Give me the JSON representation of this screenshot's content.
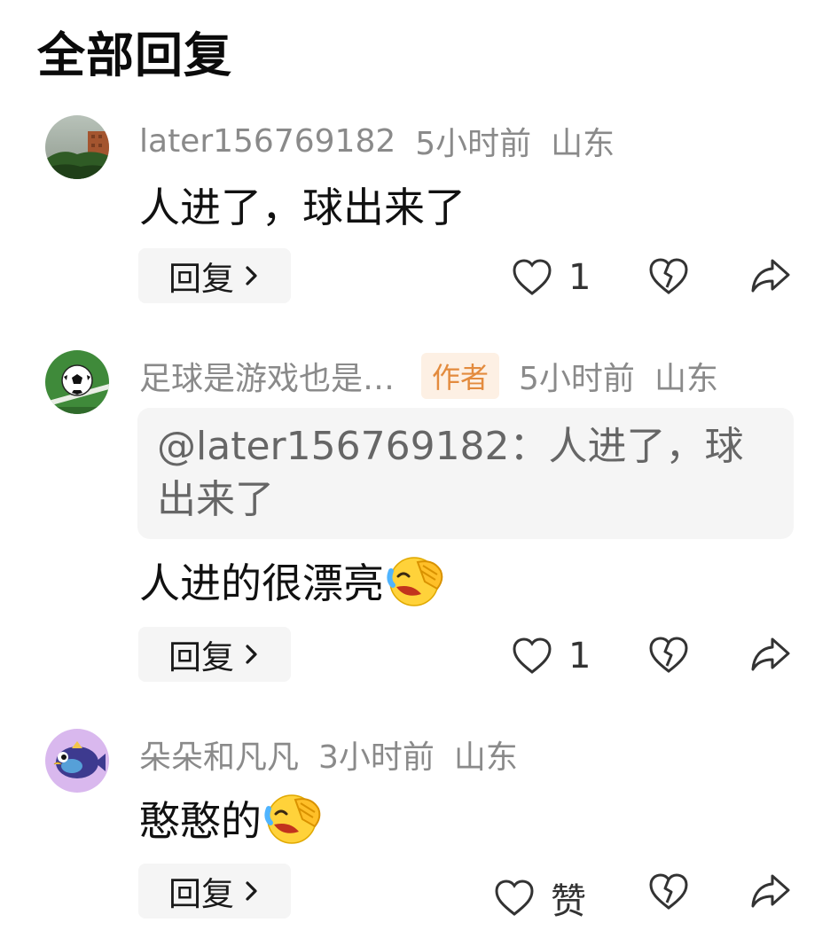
{
  "page": {
    "title": "全部回复"
  },
  "comments": [
    {
      "username": "later156769182",
      "time": "5小时前",
      "location": "山东",
      "text": "人进了，球出来了",
      "reply_label": "回复",
      "like_count": "1"
    },
    {
      "username": "足球是游戏也是…",
      "badge": "作者",
      "time": "5小时前",
      "location": "山东",
      "quote": "@later156769182：人进了，球出来了",
      "text": "人进的很漂亮",
      "emoji": "laughing-crying-emoji",
      "reply_label": "回复",
      "like_count": "1"
    },
    {
      "username": "朵朵和凡凡",
      "time": "3小时前",
      "location": "山东",
      "text": "憨憨的",
      "emoji": "laughing-crying-emoji",
      "reply_label": "回复",
      "like_label": "赞"
    }
  ],
  "icons": {
    "like": "heart-outline-icon",
    "dislike": "broken-heart-icon",
    "share": "share-arrow-icon",
    "chevron": "chevron-right-icon"
  },
  "colors": {
    "meta_text": "#8a8a8a",
    "badge_bg": "#fdf0e4",
    "badge_text": "#e38b3e",
    "button_bg": "#f5f5f5",
    "icon_stroke": "#333333"
  }
}
